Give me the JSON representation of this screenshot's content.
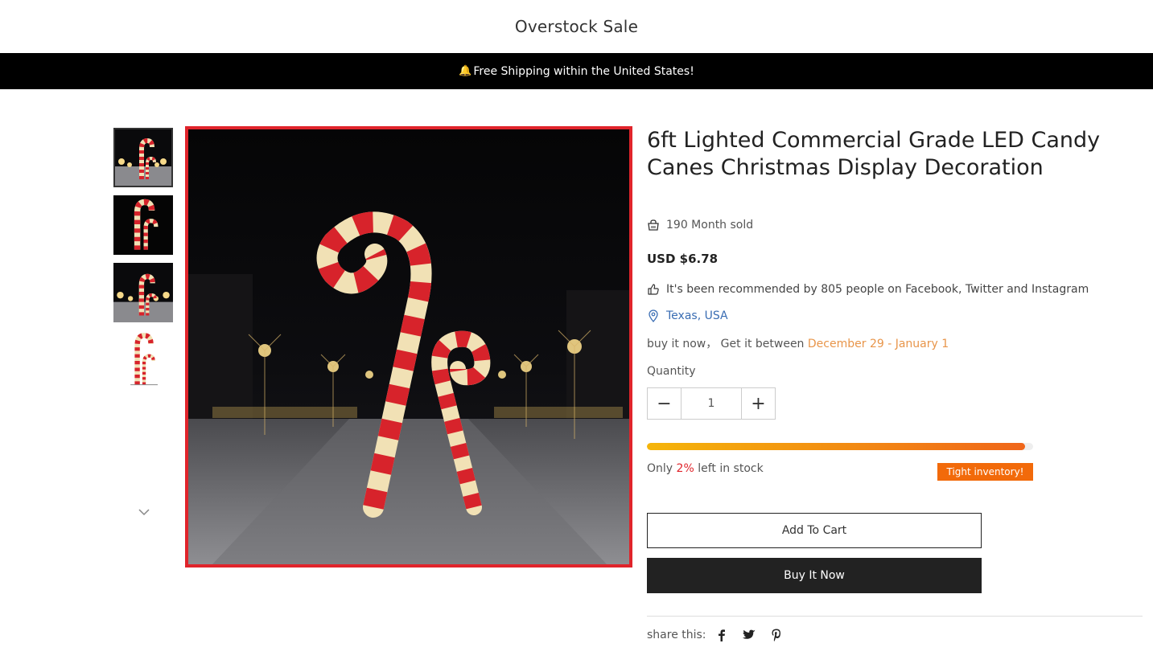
{
  "header": {
    "title": "Overstock Sale"
  },
  "announcement": {
    "icon": "bell-icon",
    "text": "Free Shipping within the United States!"
  },
  "gallery": {
    "thumbnails": [
      "candy-cane-park-night",
      "candy-cane-black-bg",
      "candy-cane-park-night",
      "candy-cane-white-bg"
    ],
    "active_index": 0,
    "scroll_icon": "chevron-down-icon"
  },
  "product": {
    "title": "6ft Lighted Commercial Grade LED Candy Canes Christmas Display Decoration",
    "sold": "190 Month sold",
    "price": "USD $6.78",
    "recommended": "It's been recommended by 805 people on Facebook, Twitter and Instagram",
    "location": "Texas, USA",
    "delivery_prefix": "buy it now， Get it between ",
    "delivery_dates": "December 29 - January 1"
  },
  "quantity": {
    "label": "Quantity",
    "value": "1",
    "minus": "−",
    "plus": "+"
  },
  "stock": {
    "level": 0.98,
    "prefix": "Only ",
    "percent": "2%",
    "suffix": " left in stock",
    "badge": "Tight inventory!"
  },
  "actions": {
    "add_to_cart": "Add To Cart",
    "buy_now": "Buy It Now"
  },
  "share": {
    "label": "share this:",
    "networks": [
      "facebook-icon",
      "twitter-icon",
      "pinterest-icon"
    ]
  },
  "colors": {
    "accent_red": "#e0242b",
    "delivery_orange": "#e8954a",
    "badge_orange": "#f26a0a",
    "location_blue": "#3a6db3"
  }
}
